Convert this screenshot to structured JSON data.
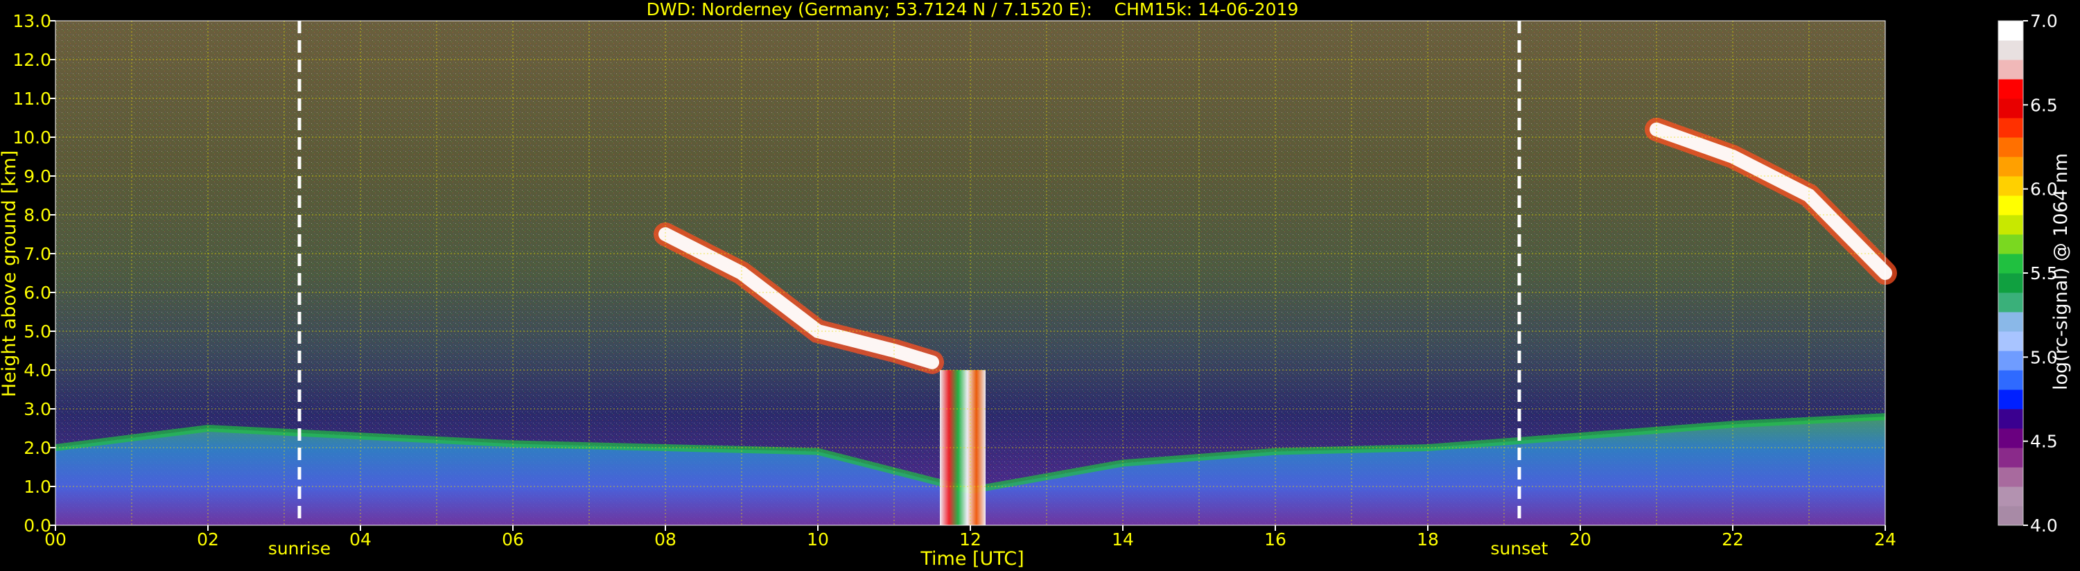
{
  "chart_data": {
    "type": "heatmap",
    "title": "DWD: Norderney (Germany; 53.7124 N / 7.1520 E):    CHM15k: 14-06-2019",
    "xlabel": "Time [UTC]",
    "ylabel": "Height above ground [km]",
    "xlim": [
      0,
      24
    ],
    "ylim": [
      0,
      13
    ],
    "x_tick_labels": [
      "00",
      "02",
      "04",
      "06",
      "08",
      "10",
      "12",
      "14",
      "16",
      "18",
      "20",
      "22",
      "24"
    ],
    "y_tick_labels": [
      "0.0",
      "1.0",
      "2.0",
      "3.0",
      "4.0",
      "5.0",
      "6.0",
      "7.0",
      "8.0",
      "9.0",
      "10.0",
      "11.0",
      "12.0",
      "13.0"
    ],
    "grid": true,
    "markers": [
      {
        "label": "sunrise",
        "time_utc": 3.2
      },
      {
        "label": "sunset",
        "time_utc": 19.2
      }
    ],
    "colorbar": {
      "label": "log(rc-signal) @ 1064 nm",
      "range": [
        4.0,
        7.0
      ],
      "tick_labels": [
        "4.0",
        "4.5",
        "5.0",
        "5.5",
        "6.0",
        "6.5",
        "7.0"
      ],
      "colors": [
        "#a88aa6",
        "#b392b0",
        "#a86a9e",
        "#8a2a8a",
        "#6a0080",
        "#3a0090",
        "#0020ff",
        "#2f6aff",
        "#6f9cff",
        "#a8c4ff",
        "#8ab8e8",
        "#3ab07a",
        "#10a040",
        "#20c040",
        "#7ad820",
        "#c8e800",
        "#ffff00",
        "#ffd000",
        "#ffa000",
        "#ff7000",
        "#ff3000",
        "#e80000",
        "#ff0000",
        "#f0b8b8",
        "#e8e0e0",
        "#ffffff"
      ]
    },
    "features": [
      {
        "kind": "boundary_layer",
        "times": [
          0,
          2,
          4,
          6,
          8,
          10,
          12,
          14,
          16,
          18,
          20,
          22,
          24
        ],
        "top_km": [
          2.0,
          2.5,
          2.3,
          2.1,
          2.0,
          1.9,
          0.9,
          1.6,
          1.9,
          2.0,
          2.3,
          2.6,
          2.8
        ]
      },
      {
        "kind": "cloud",
        "times": [
          8.0,
          9.0,
          10.0,
          11.0,
          11.5
        ],
        "heights_km": [
          7.5,
          6.5,
          5.0,
          4.5,
          4.2
        ]
      },
      {
        "kind": "cloud",
        "times": [
          21.0,
          22.0,
          23.0,
          24.0
        ],
        "heights_km": [
          10.2,
          9.5,
          8.5,
          6.5
        ]
      },
      {
        "kind": "precipitation",
        "time_utc": [
          11.6,
          12.2
        ],
        "top_km": 4.0
      }
    ]
  }
}
